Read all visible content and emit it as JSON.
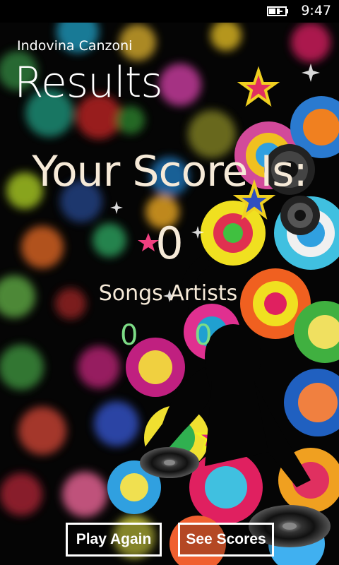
{
  "status_bar": {
    "battery_icon": "battery-charging-icon",
    "time": "9:47"
  },
  "header": {
    "app_title": "Indovina Canzoni",
    "page_title": "Results"
  },
  "score": {
    "heading": "Your Score Is:",
    "value": "0",
    "breakdown_label": "Songs Artists",
    "songs": "0",
    "artists": "0"
  },
  "buttons": {
    "play_again": "Play Again",
    "see_scores": "See Scores"
  },
  "colors": {
    "background": "#000000",
    "text_primary": "#f6ead8",
    "count_green": "#7ddc86",
    "button_border": "#ffffff"
  }
}
